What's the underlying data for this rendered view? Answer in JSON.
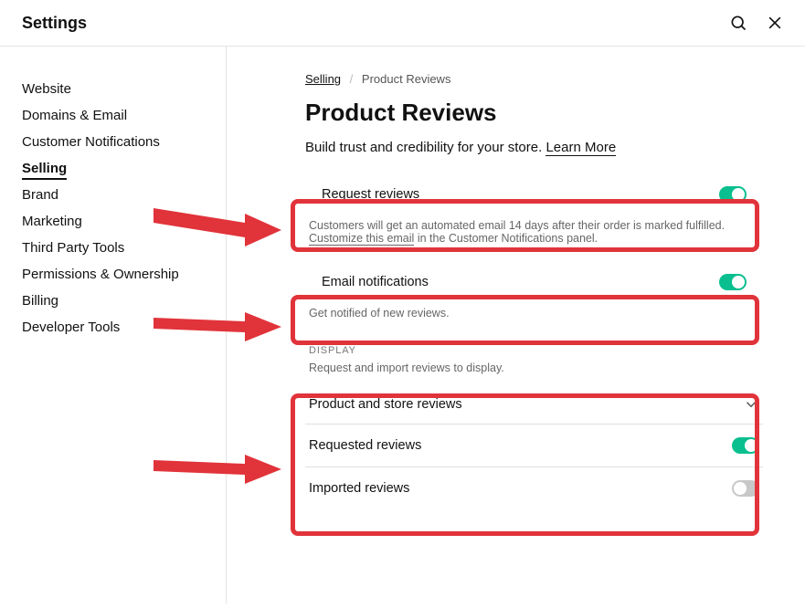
{
  "header": {
    "title": "Settings"
  },
  "sidebar": {
    "items": [
      {
        "label": "Website"
      },
      {
        "label": "Domains & Email"
      },
      {
        "label": "Customer Notifications"
      },
      {
        "label": "Selling",
        "active": true
      },
      {
        "label": "Brand"
      },
      {
        "label": "Marketing"
      },
      {
        "label": "Third Party Tools"
      },
      {
        "label": "Permissions & Ownership"
      },
      {
        "label": "Billing"
      },
      {
        "label": "Developer Tools"
      }
    ]
  },
  "breadcrumb": {
    "parent": "Selling",
    "current": "Product Reviews"
  },
  "page": {
    "title": "Product Reviews",
    "subtitle_lead": "Build trust and credibility for your store. ",
    "learn_more": "Learn More"
  },
  "rows": {
    "request_reviews": {
      "label": "Request reviews",
      "on": true,
      "help_pre": "Customers will get an automated email 14 days after their order is marked fulfilled. ",
      "help_link": "Customize this email",
      "help_post": " in the Customer Notifications panel."
    },
    "email_notifications": {
      "label": "Email notifications",
      "on": true,
      "help": "Get notified of new reviews."
    }
  },
  "display_section": {
    "header": "DISPLAY",
    "sub": "Request and import reviews to display.",
    "select_label": "Product and store reviews",
    "requested_reviews": {
      "label": "Requested reviews",
      "on": true
    },
    "imported_reviews": {
      "label": "Imported reviews",
      "on": false
    }
  }
}
